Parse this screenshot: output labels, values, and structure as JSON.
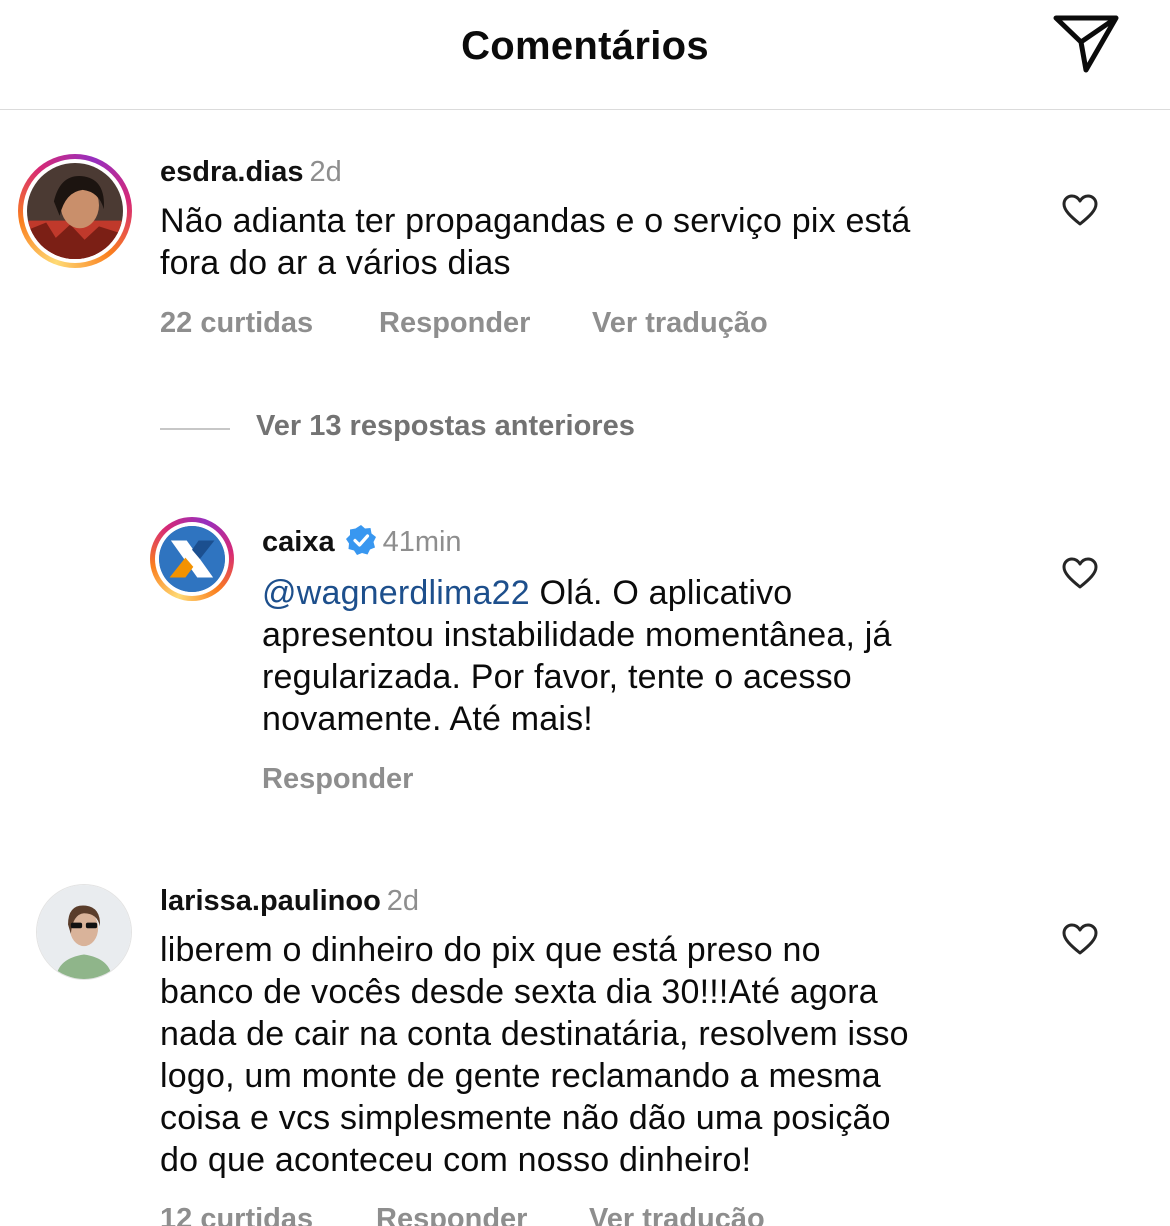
{
  "header": {
    "title": "Comentários",
    "share_icon": "paper-plane-icon"
  },
  "comments": [
    {
      "username": "esdra.dias",
      "time": "2d",
      "text_lines": [
        "Não adianta ter propagandas e o serviço pix está",
        "fora do ar a vários dias"
      ],
      "likes": "22 curtidas",
      "reply": "Responder",
      "translate": "Ver tradução"
    },
    {
      "username": "larissa.paulinoo",
      "time": "2d",
      "text_lines": [
        "liberem o dinheiro do pix que está preso no",
        "banco de vocês desde sexta dia 30!!!Até agora",
        "nada de cair na conta destinatária, resolvem isso",
        "logo, um monte de gente reclamando a mesma",
        "coisa e vcs simplesmente não dão uma posição",
        "do que aconteceu com nosso dinheiro!"
      ],
      "likes": "12 curtidas",
      "reply": "Responder",
      "translate": "Ver tradução"
    }
  ],
  "view_replies": "Ver 13 respostas anteriores",
  "reply_item": {
    "username": "caixa",
    "time": "41min",
    "mention": "@wagnerdlima22",
    "text_first": " Olá. O aplicativo",
    "text_lines": [
      "apresentou instabilidade momentânea, já",
      "regularizada. Por favor, tente o acesso",
      "novamente. Até mais!"
    ],
    "reply": "Responder"
  },
  "colors": {
    "accent_link": "#1d4f8c",
    "verified": "#3897f0",
    "muted": "#8e8e8e"
  }
}
